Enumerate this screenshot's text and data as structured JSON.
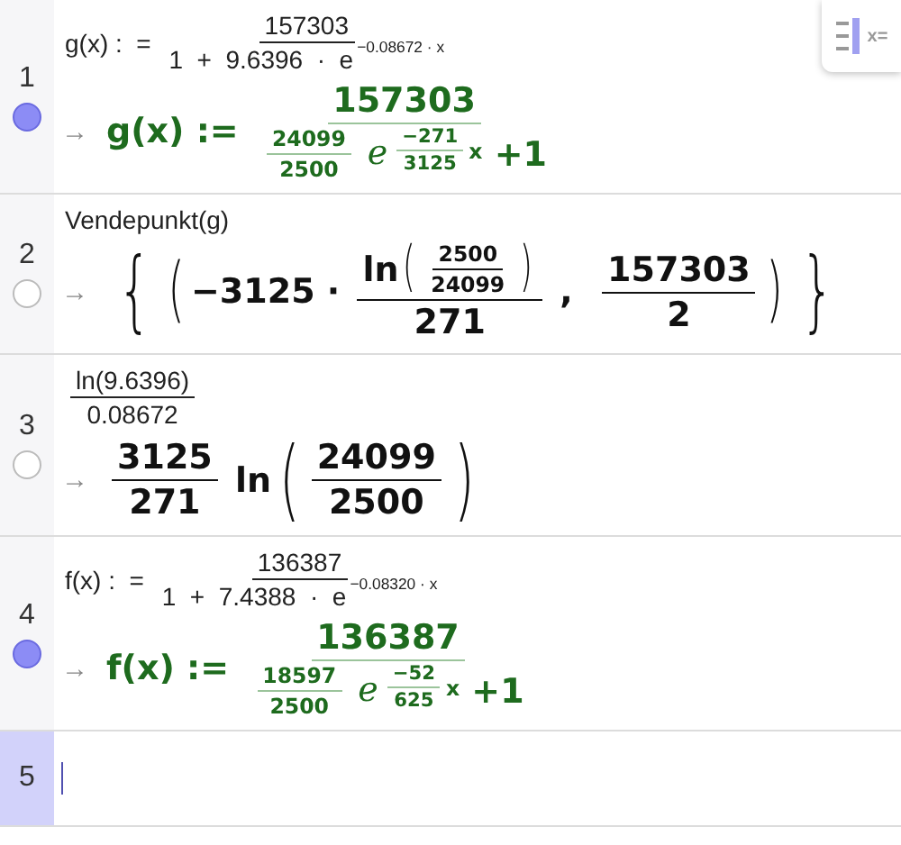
{
  "toggle_button": {
    "label": "x="
  },
  "rows": [
    {
      "number": "1",
      "selected": false,
      "visible": true,
      "input": [
        "g(x) :  = ",
        {
          "kind": "frac",
          "num": [
            "157303"
          ],
          "den": [
            "1  +  9.6396  ·  ",
            {
              "kind": "sup",
              "base": [
                "e"
              ],
              "exp": [
                "−0.08672 · x"
              ]
            }
          ]
        }
      ],
      "output": {
        "arrow": "→",
        "color": "#1e6b1e",
        "math": [
          "g(x) := ",
          {
            "kind": "frac",
            "num": [
              "157303"
            ],
            "den": [
              {
                "kind": "frac",
                "num": [
                  "24099"
                ],
                "den": [
                  "2500"
                ]
              },
              {
                "kind": "sup",
                "base": [
                  {
                    "kind": "ital",
                    "text": "e"
                  }
                ],
                "exp": [
                  {
                    "kind": "frac",
                    "num": [
                      "−271"
                    ],
                    "den": [
                      "3125"
                    ]
                  },
                  "x"
                ]
              },
              " +1"
            ]
          }
        ]
      }
    },
    {
      "number": "2",
      "selected": false,
      "visible": false,
      "input": [
        "Vendepunkt(g)"
      ],
      "output": {
        "arrow": "→",
        "math": [
          {
            "kind": "paren",
            "open": "{",
            "close": "}",
            "body": [
              {
                "kind": "paren",
                "open": "(",
                "close": ")",
                "body": [
                  "−3125 · ",
                  {
                    "kind": "frac",
                    "num": [
                      "ln",
                      {
                        "kind": "paren",
                        "open": "(",
                        "close": ")",
                        "body": [
                          {
                            "kind": "frac",
                            "num": [
                              "2500"
                            ],
                            "den": [
                              "24099"
                            ]
                          }
                        ]
                      }
                    ],
                    "den": [
                      "271"
                    ]
                  },
                  " ,  ",
                  {
                    "kind": "frac",
                    "num": [
                      "157303"
                    ],
                    "den": [
                      "2"
                    ]
                  }
                ]
              }
            ]
          }
        ]
      }
    },
    {
      "number": "3",
      "selected": false,
      "visible": false,
      "input": [
        {
          "kind": "frac",
          "num": [
            "ln(9.6396)"
          ],
          "den": [
            "0.08672"
          ]
        }
      ],
      "output": {
        "arrow": "→",
        "math": [
          {
            "kind": "frac",
            "num": [
              "3125"
            ],
            "den": [
              "271"
            ]
          },
          " ln",
          {
            "kind": "paren",
            "open": "(",
            "close": ")",
            "body": [
              {
                "kind": "frac",
                "num": [
                  "24099"
                ],
                "den": [
                  "2500"
                ]
              }
            ]
          }
        ]
      }
    },
    {
      "number": "4",
      "selected": false,
      "visible": true,
      "input": [
        "f(x) :  = ",
        {
          "kind": "frac",
          "num": [
            "136387"
          ],
          "den": [
            "1  +  7.4388  ·  ",
            {
              "kind": "sup",
              "base": [
                "e"
              ],
              "exp": [
                "−0.08320 · x"
              ]
            }
          ]
        }
      ],
      "output": {
        "arrow": "→",
        "color": "#1e6b1e",
        "math": [
          "f(x) := ",
          {
            "kind": "frac",
            "num": [
              "136387"
            ],
            "den": [
              {
                "kind": "frac",
                "num": [
                  "18597"
                ],
                "den": [
                  "2500"
                ]
              },
              {
                "kind": "sup",
                "base": [
                  {
                    "kind": "ital",
                    "text": "e"
                  }
                ],
                "exp": [
                  {
                    "kind": "frac",
                    "num": [
                      "−52"
                    ],
                    "den": [
                      "625"
                    ]
                  },
                  "x"
                ]
              },
              " +1"
            ]
          }
        ]
      }
    },
    {
      "number": "5",
      "selected": true
    }
  ]
}
